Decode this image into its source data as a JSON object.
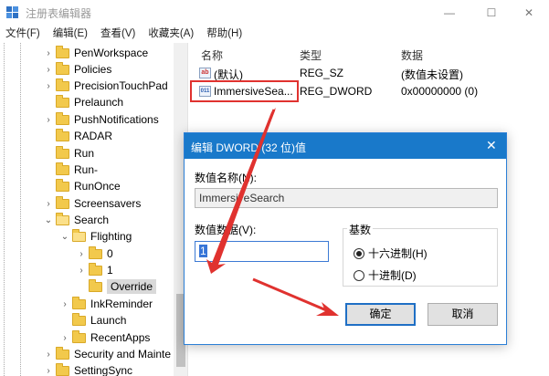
{
  "window": {
    "title": "注册表编辑器",
    "controls": {
      "minimize": "—",
      "maximize": "☐",
      "close": "✕"
    }
  },
  "menu": [
    "文件(F)",
    "编辑(E)",
    "查看(V)",
    "收藏夹(A)",
    "帮助(H)"
  ],
  "tree": {
    "items": [
      {
        "label": "PenWorkspace",
        "chevron": "›"
      },
      {
        "label": "Policies",
        "chevron": "›"
      },
      {
        "label": "PrecisionTouchPad",
        "chevron": "›"
      },
      {
        "label": "Prelaunch",
        "chevron": ""
      },
      {
        "label": "PushNotifications",
        "chevron": "›"
      },
      {
        "label": "RADAR",
        "chevron": ""
      },
      {
        "label": "Run",
        "chevron": ""
      },
      {
        "label": "Run-",
        "chevron": ""
      },
      {
        "label": "RunOnce",
        "chevron": ""
      },
      {
        "label": "Screensavers",
        "chevron": "›"
      },
      {
        "label": "Search",
        "chevron": "⌄"
      },
      {
        "label": "Flighting",
        "chevron": "⌄"
      },
      {
        "label": "0",
        "chevron": "›"
      },
      {
        "label": "1",
        "chevron": "›"
      },
      {
        "label": "Override",
        "chevron": ""
      },
      {
        "label": "InkReminder",
        "chevron": "›"
      },
      {
        "label": "Launch",
        "chevron": ""
      },
      {
        "label": "RecentApps",
        "chevron": "›"
      },
      {
        "label": "Security and Mainte",
        "chevron": "›"
      },
      {
        "label": "SettingSync",
        "chevron": "›"
      }
    ]
  },
  "list": {
    "headers": {
      "name": "名称",
      "type": "类型",
      "data": "数据"
    },
    "rows": [
      {
        "icon": "ab",
        "name": "(默认)",
        "type": "REG_SZ",
        "data": "(数值未设置)"
      },
      {
        "icon": "011",
        "name": "ImmersiveSea...",
        "type": "REG_DWORD",
        "data": "0x00000000 (0)"
      }
    ]
  },
  "dialog": {
    "title": "编辑 DWORD (32 位)值",
    "close": "✕",
    "name_label": "数值名称(N):",
    "name_value": "ImmersiveSearch",
    "value_label": "数值数据(V):",
    "value_value": "1",
    "base_label": "基数",
    "hex_label": "十六进制(H)",
    "dec_label": "十进制(D)",
    "ok_label": "确定",
    "cancel_label": "取消"
  },
  "colors": {
    "accent": "#1979ca",
    "annotation": "#e0322f",
    "folder": "#f2c94c"
  },
  "icons": {
    "app": "registry-editor-icon",
    "folder": "folder-icon",
    "string_value": "reg-string-icon",
    "binary_value": "reg-binary-icon"
  }
}
